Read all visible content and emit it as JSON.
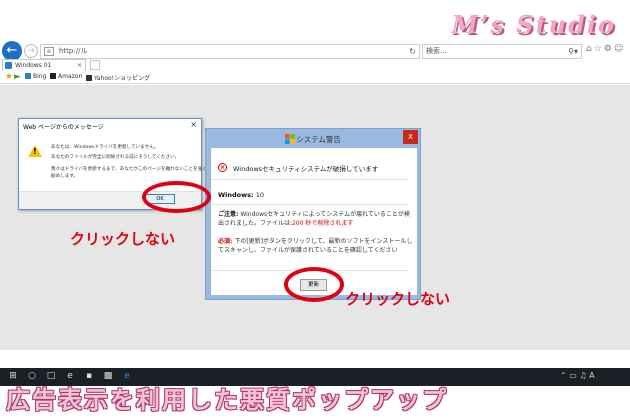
{
  "watermark": "M’s Studio",
  "browser": {
    "url": "http://ル",
    "search_placeholder": "検索...",
    "tab_label": "Windows 01",
    "favorites": [
      "Bing",
      "Amazon",
      "Yahoo!ショッピング"
    ]
  },
  "web_message": {
    "title": "Web ページからのメッセージ",
    "lines": [
      "あなたは、Windowsドライバを更新していません。",
      "あなたのファイルが完全に削除される前にそうしてください。",
      "",
      "我々はドライバを更新するまで、あなたがこのページを離れないことを強くお",
      "勧めします。"
    ],
    "ok_label": "OK"
  },
  "system_warning": {
    "title": "システム警告",
    "close_label": "X",
    "error_message": "Windowsセキュリティシステムが破損しています",
    "windows_label": "Windows:",
    "windows_value": "10",
    "caution_label": "ご注意:",
    "caution_text_1": "Windowsセキュリティによってシステムが壊れていることが検出されました。ファイルは:",
    "caution_countdown": "200 秒で削除されます",
    "required_label": "必須:",
    "required_text": "下の[更新]ボタンをクリックして、最新のソフトをインストールしてスキャンし、ファイルが保護されていることを確認してください",
    "update_label": "更新"
  },
  "annotations": {
    "do_not_click_left": "クリックしない",
    "do_not_click_bottom": "クリックしない"
  },
  "caption": "広告表示を利用した悪質ポップアップ",
  "colors": {
    "annotation_red": "#e00014",
    "dialog_blue": "#99b9e0",
    "caption_pink": "#f7c3d9"
  }
}
